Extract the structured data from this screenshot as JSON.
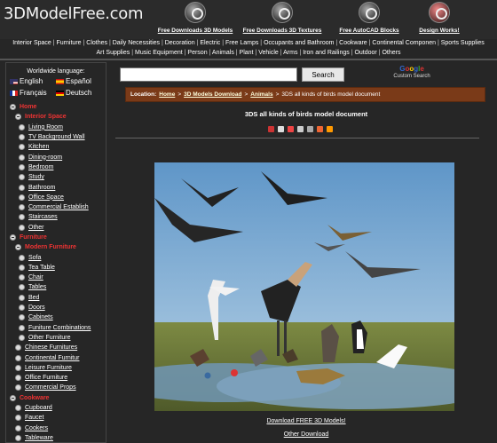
{
  "site": {
    "logo": "3DModelFree.com"
  },
  "top_links": [
    {
      "label": "Free Downloads 3D Models"
    },
    {
      "label": "Free Downloads 3D Textures"
    },
    {
      "label": "Free AutoCAD Blocks"
    },
    {
      "label": "Design Works!"
    }
  ],
  "category_nav": {
    "line1": [
      "Interior Space",
      "Furniture",
      "Clothes",
      "Daily Necessities",
      "Decoration",
      "Electric",
      "Free Lamps",
      "Occupants and Bathroom",
      "Cookware",
      "Continental Componen",
      "Sports Supplies"
    ],
    "line2": [
      "Art Supplies",
      "Music Equipment",
      "Person",
      "Animals",
      "Plant",
      "Vehicle",
      "Arms",
      "Iron and Railings",
      "Outdoor",
      "Others"
    ],
    "separator": "|"
  },
  "sidebar": {
    "language_title": "Worldwide language:",
    "languages": [
      {
        "label": "English",
        "flag": "en"
      },
      {
        "label": "Español",
        "flag": "es"
      },
      {
        "label": "Français",
        "flag": "fr"
      },
      {
        "label": "Deutsch",
        "flag": "de"
      }
    ],
    "tree": [
      {
        "label": "Home",
        "level": 0,
        "red": true,
        "expanded": true
      },
      {
        "label": "Interior Space",
        "level": 1,
        "red": true,
        "expanded": true
      },
      {
        "label": "Living Room",
        "level": 2
      },
      {
        "label": "TV Background Wall",
        "level": 2
      },
      {
        "label": "Kitchen",
        "level": 2
      },
      {
        "label": "Dining-room",
        "level": 2
      },
      {
        "label": "Bedroom",
        "level": 2
      },
      {
        "label": "Study",
        "level": 2
      },
      {
        "label": "Bathroom",
        "level": 2
      },
      {
        "label": "Office Space",
        "level": 2
      },
      {
        "label": "Commercial Establish",
        "level": 2
      },
      {
        "label": "Staircases",
        "level": 2
      },
      {
        "label": "Other",
        "level": 2
      },
      {
        "label": "Furniture",
        "level": 0,
        "red": true,
        "expanded": true
      },
      {
        "label": "Modern Furniture",
        "level": 1,
        "red": true,
        "expanded": true
      },
      {
        "label": "Sofa",
        "level": 2
      },
      {
        "label": "Tea Table",
        "level": 2
      },
      {
        "label": "Chair",
        "level": 2
      },
      {
        "label": "Tables",
        "level": 2
      },
      {
        "label": "Bed",
        "level": 2
      },
      {
        "label": "Doors",
        "level": 2
      },
      {
        "label": "Cabinets",
        "level": 2
      },
      {
        "label": "Funiture Combinations",
        "level": 2
      },
      {
        "label": "Other Furniture",
        "level": 2
      },
      {
        "label": "Chinese Furnitures",
        "level": 1
      },
      {
        "label": "Continental Furnitur",
        "level": 1
      },
      {
        "label": "Leisure Furniture",
        "level": 1
      },
      {
        "label": "Office Furniture",
        "level": 1
      },
      {
        "label": "Commercial Props",
        "level": 1
      },
      {
        "label": "Cookware",
        "level": 0,
        "red": true,
        "expanded": true
      },
      {
        "label": "Cupboard",
        "level": 1
      },
      {
        "label": "Faucet",
        "level": 1
      },
      {
        "label": "Cookers",
        "level": 1
      },
      {
        "label": "Tableware",
        "level": 1
      }
    ]
  },
  "search": {
    "placeholder": "",
    "button_label": "Search"
  },
  "google": {
    "letters": [
      "G",
      "o",
      "o",
      "g",
      "l",
      "e"
    ],
    "caption": "Custom Search"
  },
  "location": {
    "prefix": "Location:",
    "crumbs": [
      "Home",
      "3D Models Download",
      "Animals"
    ],
    "separator": ">",
    "current": "3DS all kinds of birds model document"
  },
  "document": {
    "title": "3DS all kinds of birds model document",
    "share_icons": [
      "bookmark-icon",
      "share-icon",
      "digg-icon",
      "delicious-icon",
      "myspace-icon",
      "facebook-icon",
      "rss-icon"
    ],
    "share_colors": [
      "#c33",
      "#ddd",
      "#e44",
      "#ccc",
      "#aaa",
      "#e63",
      "#f90"
    ],
    "download_label": "Download FREE 3D Models!",
    "other_download_label": "Other Download"
  }
}
